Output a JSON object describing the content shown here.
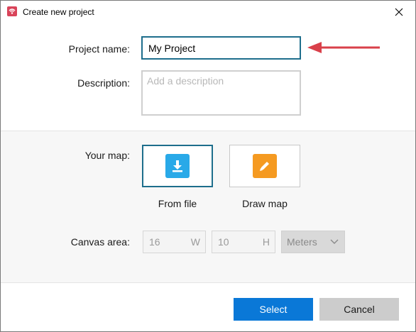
{
  "window": {
    "title": "Create new project"
  },
  "form": {
    "project_name_label": "Project name:",
    "project_name_value": "My Project",
    "description_label": "Description:",
    "description_placeholder": "Add a description",
    "your_map_label": "Your map:",
    "map_options": [
      {
        "label": "From file",
        "icon": "download-icon",
        "color": "#29a9e8",
        "selected": true
      },
      {
        "label": "Draw map",
        "icon": "pencil-icon",
        "color": "#f59a21",
        "selected": false
      }
    ],
    "canvas_area_label": "Canvas area:",
    "width_value": "16",
    "width_unit": "W",
    "height_value": "10",
    "height_unit": "H",
    "units_value": "Meters"
  },
  "footer": {
    "select_label": "Select",
    "cancel_label": "Cancel"
  },
  "colors": {
    "accent": "#0a78d7",
    "focus_border": "#1e6e8c",
    "annotation_arrow": "#d9404a"
  }
}
